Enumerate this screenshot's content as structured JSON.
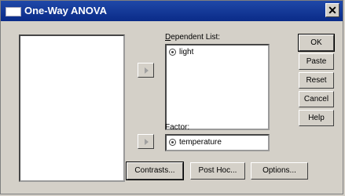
{
  "window": {
    "title": "One-Way ANOVA",
    "close_glyph": "✕"
  },
  "labels": {
    "dependent_list": "Dependent List:",
    "factor": "Factor:"
  },
  "dependent_items": [
    {
      "label": "light",
      "icon": "scale-variable-icon"
    }
  ],
  "factor_item": {
    "label": "temperature",
    "icon": "scale-variable-icon"
  },
  "buttons": {
    "ok": "OK",
    "paste": "Paste",
    "reset": "Reset",
    "cancel": "Cancel",
    "help": "Help",
    "contrasts": "Contrasts...",
    "post_hoc": "Post Hoc...",
    "options": "Options..."
  },
  "colors": {
    "title_bar": "#0a2b88",
    "face": "#d4d0c8"
  }
}
